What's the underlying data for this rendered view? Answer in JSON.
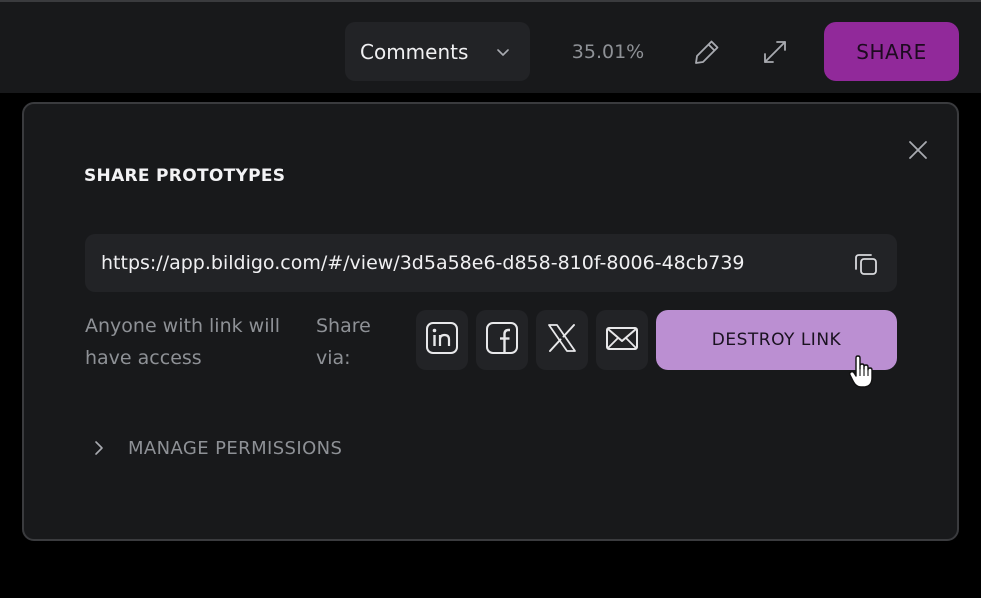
{
  "toolbar": {
    "mode_label": "Comments",
    "zoom_level": "35.01%",
    "share_label": "SHARE",
    "icons": [
      "chevron-down-icon",
      "pencil-icon",
      "expand-icon"
    ]
  },
  "share_modal": {
    "title": "SHARE PROTOTYPES",
    "link_url": "https://app.bildigo.com/#/view/3d5a58e6-d858-810f-8006-48cb739",
    "access_note": "Anyone with link will have access",
    "share_via_label": "Share via:",
    "share_targets": [
      "linkedin-icon",
      "facebook-icon",
      "x-twitter-icon",
      "email-icon"
    ],
    "destroy_label": "DESTROY LINK",
    "manage_permissions_label": "MANAGE PERMISSIONS"
  },
  "colors": {
    "background": "#000000",
    "panel": "#18191b",
    "field": "#222326",
    "share_button": "#91299a",
    "destroy_button": "#bb8fd2",
    "muted_text": "#8e9196"
  }
}
